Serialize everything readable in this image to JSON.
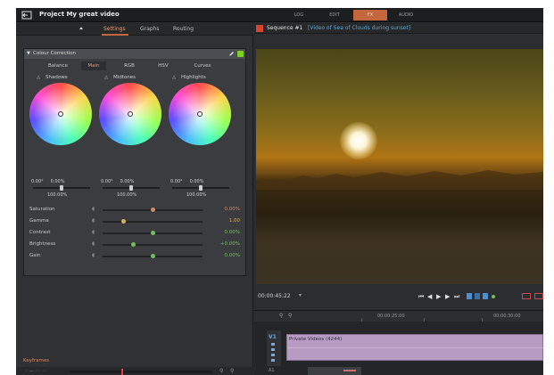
{
  "topbar": {
    "project_title": "Project My great video",
    "tabs": [
      {
        "label": "LOG",
        "active": false
      },
      {
        "label": "EDIT",
        "active": false
      },
      {
        "label": "FX",
        "active": true
      },
      {
        "label": "AUDIO",
        "active": false
      }
    ]
  },
  "left": {
    "tabs": {
      "settings": "Settings",
      "graphs": "Graphs",
      "routing": "Routing"
    },
    "cc": {
      "title": "Colour Correction",
      "subtabs": [
        "Balance",
        "Main",
        "RGB",
        "HSV",
        "Curves"
      ],
      "active_subtab": "Main",
      "wheels": [
        {
          "label": "Shadows",
          "val_a": "0.00°",
          "val_b": "0.00%",
          "pct": "100.00%"
        },
        {
          "label": "Midtones",
          "val_a": "0.00°",
          "val_b": "0.00%",
          "pct": "100.00%"
        },
        {
          "label": "Highlights",
          "val_a": "0.00°",
          "val_b": "0.00%",
          "pct": "100.00%"
        }
      ],
      "params": [
        {
          "label": "Saturation",
          "value": "0.00%",
          "level": 0.5,
          "color": "#d88a5e"
        },
        {
          "label": "Gamma",
          "value": "1.00",
          "level": 0.2,
          "color": "#d8b25e"
        },
        {
          "label": "Contrast",
          "value": "0.00%",
          "level": 0.5,
          "color": "#6fc25a"
        },
        {
          "label": "Brightness",
          "value": "+0.00%",
          "level": 0.3,
          "color": "#6fc25a"
        },
        {
          "label": "Gain",
          "value": "0.00%",
          "level": 0.5,
          "color": "#6fc25a"
        }
      ]
    },
    "keyframes": {
      "label": "Keyframes",
      "controls": "◦ — ◦◦ ◦◦"
    }
  },
  "right": {
    "sequence_label": "Sequence #1",
    "clip_name": "[Video of Sea of Clouds during sunset]",
    "timecode": "00:00:45:22",
    "ruler_times": [
      "00:00:25:00",
      "00:00:30:00"
    ],
    "track_label": "V1",
    "clip_title": "Private Videos (4244)",
    "audio_label": "A1"
  },
  "colors": {
    "accent": "#c4673f",
    "rec": "#d8452f",
    "link": "#5aa6d6",
    "clip": "#b79bc2"
  },
  "icons": [
    "back-icon",
    "pen-icon",
    "toggle-on-icon",
    "eye-icon",
    "zoom-in-icon",
    "zoom-out-icon"
  ]
}
